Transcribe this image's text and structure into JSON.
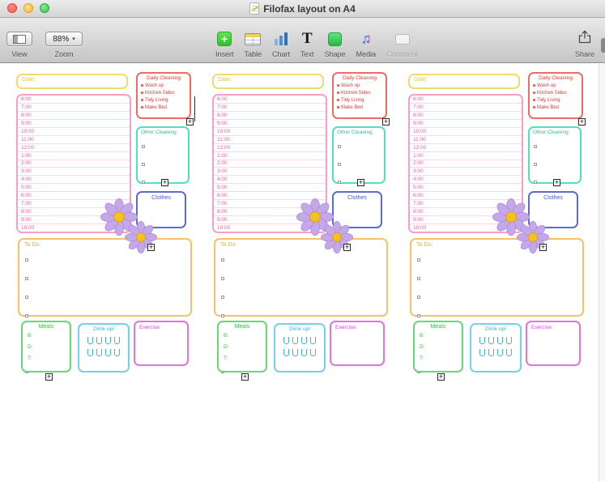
{
  "window": {
    "title": "Filofax layout on A4"
  },
  "toolbar": {
    "view_label": "View",
    "zoom_label": "Zoom",
    "zoom_value": "88%",
    "insert_label": "Insert",
    "table_label": "Table",
    "chart_label": "Chart",
    "text_label": "Text",
    "shape_label": "Shape",
    "media_label": "Media",
    "comment_label": "Comment",
    "share_label": "Share"
  },
  "planner": {
    "date_label": "Date:",
    "schedule_times": [
      "6:00",
      "7:00",
      "8:00",
      "9:00",
      "10:00",
      "11:00",
      "12:00",
      "1:00",
      "2:00",
      "3:00",
      "4:00",
      "5:00",
      "6:00",
      "7:00",
      "8:00",
      "9:00",
      "10:00"
    ],
    "daily_cleaning": {
      "title": "Daily Cleaning",
      "items": [
        "Wash up",
        "Kitchen Sides",
        "Tidy Living",
        "Make Bed"
      ]
    },
    "other_cleaning": {
      "title": "Other Cleaning",
      "checkbox_rows": 6
    },
    "clothes_title": "Clothes",
    "todo": {
      "title": "To Do:",
      "checkbox_rows": 7
    },
    "meals": {
      "title": "Meals",
      "labels": [
        "B:",
        "D:",
        "T:"
      ]
    },
    "drink": {
      "title": "Drink up!",
      "rows": 2,
      "cups_per_row": 4
    },
    "exercise_title": "Exercise:"
  },
  "colors": {
    "yellowBorder": "#f0dc6e",
    "yellowText": "#e2c83e",
    "pinkBorder": "#f79fc7",
    "pinkText": "#ee5f9f",
    "pinkLine": "#f9d7e7",
    "redBorder": "#ef6c64",
    "redText": "#e63c34",
    "tealBorder": "#52dfc3",
    "tealText": "#27c3a3",
    "blueBorder": "#5a6ccf",
    "blueText": "#4a5cc4",
    "orangeBorder": "#f6c168",
    "orangeText": "#eda93c",
    "greenBorder": "#65db73",
    "greenText": "#33c34b",
    "cyanBorder": "#72d1ed",
    "cyanText": "#3eb3db",
    "magentaBorder": "#e273e2",
    "magentaText": "#d24ad2",
    "checkboxGray": "#9a9a9a",
    "flowerPetal": "#c5a8ea",
    "flowerPetalStroke": "#a787d3",
    "flowerCenter": "#f3c21f",
    "tableHeaderYellow": "#f7cf58"
  }
}
